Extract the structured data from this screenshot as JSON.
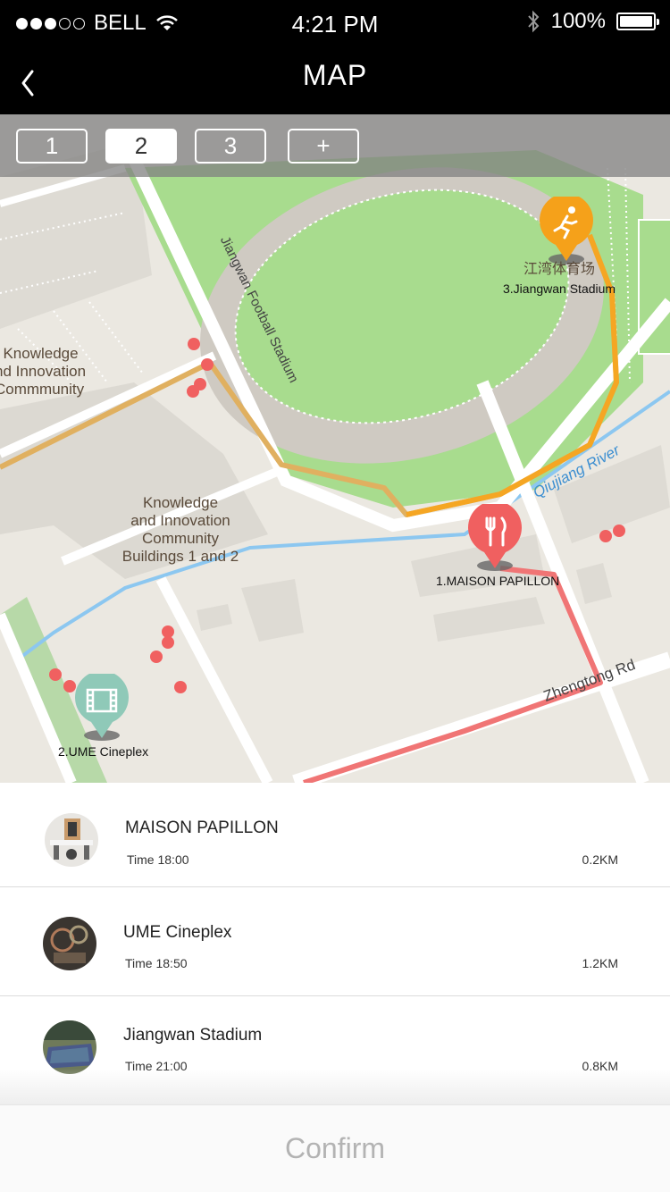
{
  "status_bar": {
    "carrier": "BELL",
    "time": "4:21 PM",
    "battery": "100%",
    "battery_level": 1.0
  },
  "nav": {
    "title": "MAP",
    "back_icon": "chevron-left-icon"
  },
  "tabs": [
    {
      "label": "1",
      "active": false
    },
    {
      "label": "2",
      "active": true
    },
    {
      "label": "3",
      "active": false
    },
    {
      "label": "+",
      "active": false
    }
  ],
  "map": {
    "area_labels": {
      "community": "Knowledge\nand Innovation\nCommmunity",
      "buildings": "Knowledge\nand Innovation\nCommunity\nBuildings 1 and 2",
      "stadium_cn": "江湾体育场"
    },
    "road_labels": {
      "football_stadium": "Jiangwan Football Stadium",
      "river": "Qiujiang River",
      "road": "Zhengtong Rd"
    },
    "pins": [
      {
        "label": "1.MAISON PAPILLON",
        "icon": "fork-knife-icon",
        "color": "#f06060"
      },
      {
        "label": "2.UME Cineplex",
        "icon": "film-icon",
        "color": "#8fc9b8"
      },
      {
        "label": "3.Jiangwan Stadium",
        "icon": "runner-icon",
        "color": "#f5a11a"
      }
    ]
  },
  "list": [
    {
      "name": "MAISON PAPILLON",
      "time": "Time 18:00",
      "distance": "0.2KM"
    },
    {
      "name": "UME Cineplex",
      "time": "Time 18:50",
      "distance": "1.2KM"
    },
    {
      "name": "Jiangwan Stadium",
      "time": "Time 21:00",
      "distance": "0.8KM"
    }
  ],
  "confirm_label": "Confirm",
  "colors": {
    "route_orange": "#f5a623",
    "route_red": "#f06060",
    "park_green": "#a8dc8e",
    "river_blue": "#8cc7f0"
  }
}
